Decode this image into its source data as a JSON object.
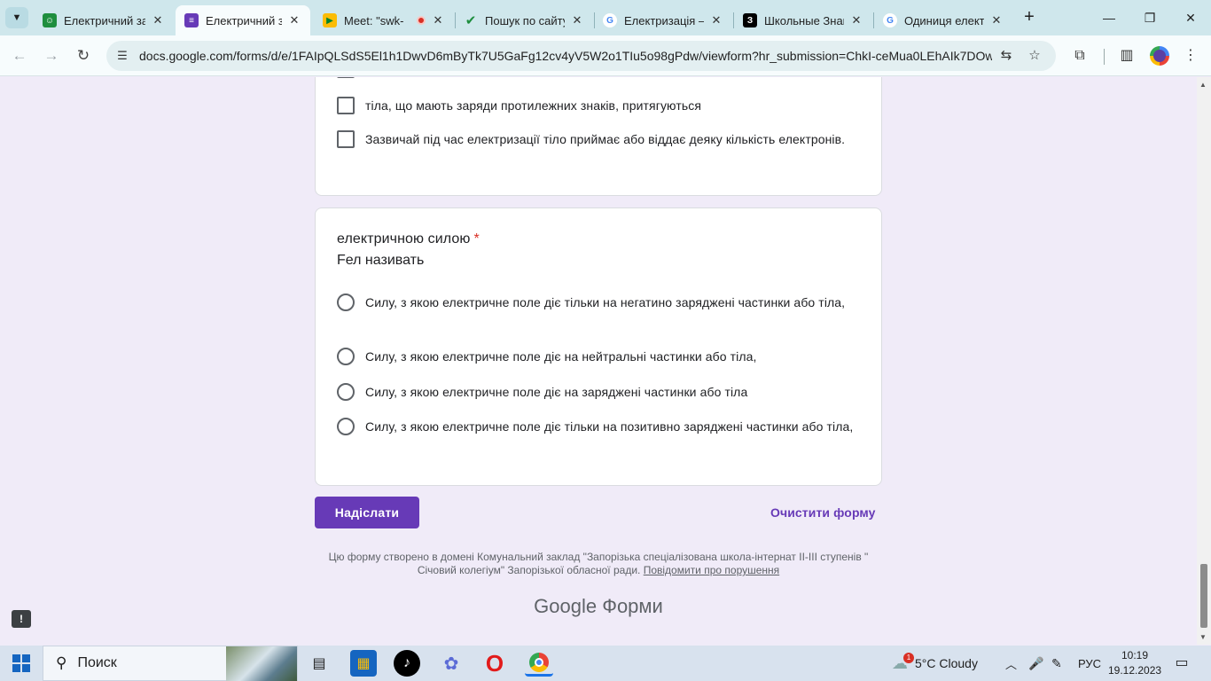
{
  "browser": {
    "tabs": [
      {
        "title": "Електричний за",
        "favicon": "classroom-icon",
        "color": "#1e8e3e",
        "active": false
      },
      {
        "title": "Електричний за",
        "favicon": "forms-icon",
        "color": "#673ab7",
        "active": true
      },
      {
        "title": "Meet: \"swk-",
        "favicon": "meet-icon",
        "color": "#00832d",
        "active": false
      },
      {
        "title": "Пошук по сайту",
        "favicon": "check-icon",
        "color": "#1a73e8",
        "active": false
      },
      {
        "title": "Електризація —",
        "favicon": "google-icon",
        "color": "#4285f4",
        "active": false
      },
      {
        "title": "Школьные Знан",
        "favicon": "znaniya-icon",
        "color": "#000000",
        "active": false
      },
      {
        "title": "Одиниця елект",
        "favicon": "google-icon",
        "color": "#4285f4",
        "active": false
      }
    ],
    "url": "docs.google.com/forms/d/e/1FAIpQLSdS5El1h1DwvD6mByTk7U5GaFg12cv4yV5W2o1TIu5o98gPdw/viewform?hr_submission=ChkI-ceMua0LEhAIk7DOw-..."
  },
  "form": {
    "prev_question": {
      "options": [
        "тіла, що мають заряди протилежних знаків, притягуються",
        "Зазвичай під час електризації тіло приймає або віддає деяку кількість електронів."
      ]
    },
    "question": {
      "title": "електричною силою",
      "required_mark": "*",
      "subtitle": "Fел називать",
      "options": [
        "Силу, з якою електричне поле діє тільки на негатино заряджені частинки або тіла,",
        "Силу, з якою електричне поле діє на нейтральні частинки або тіла,",
        "Силу, з якою електричне поле діє на заряджені частинки або тіла",
        "Силу, з якою електричне поле діє тільки на позитивно заряджені частинки або тіла,"
      ]
    },
    "submit_label": "Надіслати",
    "clear_label": "Очистити форму",
    "footer_text": "Цю форму створено в домені Комунальний заклад \"Запорізька спеціалізована школа-інтернат II-III ступенів \" Січовий колегіум\" Запорізької обласної ради.",
    "report_link": "Повідомити про порушення",
    "brand_google": "Google",
    "brand_forms": "Форми",
    "accent_color": "#673ab7"
  },
  "taskbar": {
    "search_label": "Поиск",
    "weather": "5°C  Cloudy",
    "weather_badge": "1",
    "language": "РУС",
    "time": "10:19",
    "date": "19.12.2023"
  }
}
